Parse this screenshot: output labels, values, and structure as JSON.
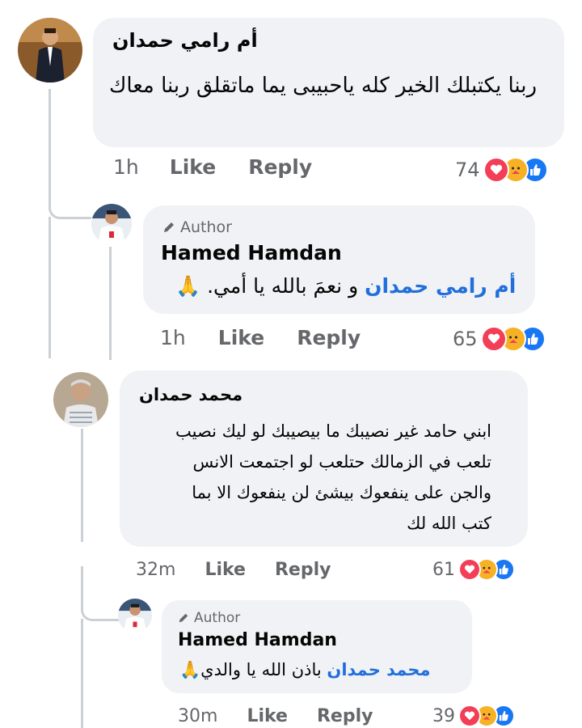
{
  "comments": [
    {
      "name": "أم رامي حمدان",
      "text": "ربنا يكتبلك الخير كله ياحبيبى يما ماتقلق ربنا معاك",
      "time": "1h",
      "like": "Like",
      "reply": "Reply",
      "reactions": "74",
      "reply_comment": {
        "badge": "Author",
        "name": "Hamed Hamdan",
        "mention": "أم رامي حمدان",
        "text": " و نعمَ بالله يا أمي. 🙏",
        "time": "1h",
        "like": "Like",
        "reply": "Reply",
        "reactions": "65"
      }
    },
    {
      "name": "محمد حمدان",
      "text_lines": [
        "ابني حامد غير نصيبك ما بيصيبك لو ليك نصيب",
        "تلعب  في الزمالك حتلعب لو اجتمعت الانس",
        "والجن على ينفعوك بيشئ لن  ينفعوك الا بما",
        "كتب الله لك"
      ],
      "time": "32m",
      "like": "Like",
      "reply": "Reply",
      "reactions": "61",
      "reply_comment": {
        "badge": "Author",
        "name": "Hamed Hamdan",
        "mention": "محمد حمدان",
        "text": " باذن الله يا والدي🙏",
        "time": "30m",
        "like": "Like",
        "reply": "Reply",
        "reactions": "39"
      }
    }
  ],
  "colors": {
    "like_blue": "#1877f2",
    "love_red": "#f33e58",
    "care_yellow": "#f7b125",
    "mention_blue": "#216fdb"
  }
}
